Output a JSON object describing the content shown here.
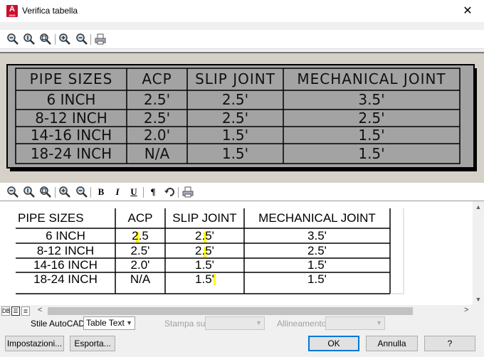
{
  "window": {
    "title": "Verifica tabella",
    "app_icon": "A",
    "app_icon_sub": "2010"
  },
  "preview_table": {
    "headers": [
      "PIPE SIZES",
      "ACP",
      "SLIP JOINT",
      "MECHANICAL JOINT"
    ],
    "rows": [
      [
        "6 INCH",
        "2.5'",
        "2.5'",
        "3.5'"
      ],
      [
        "8-12 INCH",
        "2.5'",
        "2.5'",
        "2.5'"
      ],
      [
        "14-16 INCH",
        "2.0'",
        "1.5'",
        "1.5'"
      ],
      [
        "18-24 INCH",
        "N/A",
        "1.5'",
        "1.5'"
      ]
    ]
  },
  "edit_table": {
    "headers": [
      "PIPE SIZES",
      "ACP",
      "SLIP JOINT",
      "MECHANICAL JOINT"
    ],
    "rows": [
      [
        "6 INCH",
        "2.5",
        "2.5'",
        "3.5'"
      ],
      [
        "8-12 INCH",
        "2.5'",
        "2.5'",
        "2.5'"
      ],
      [
        "14-16 INCH",
        "2.0'",
        "1.5'",
        "1.5'"
      ],
      [
        "18-24 INCH",
        "N/A",
        "1.5'",
        "1.5'"
      ]
    ]
  },
  "format_buttons": {
    "bold": "B",
    "italic": "I",
    "underline": "U",
    "paragraph": "¶"
  },
  "view_mode_buttons": [
    "DB",
    "☰",
    "≣"
  ],
  "options": {
    "style_label": "Stile AutoCAD:",
    "style_value": "Table Text",
    "print_label": "Stampa su:",
    "print_value": "",
    "align_label": "Allineamento:",
    "align_value": ""
  },
  "buttons": {
    "settings": "Impostazioni...",
    "export": "Esporta...",
    "ok": "OK",
    "cancel": "Annulla",
    "help": "?"
  },
  "colors": {
    "highlight": "#ffff00",
    "preview_bg": "#a3a3a3",
    "app_red": "#c8102e"
  }
}
